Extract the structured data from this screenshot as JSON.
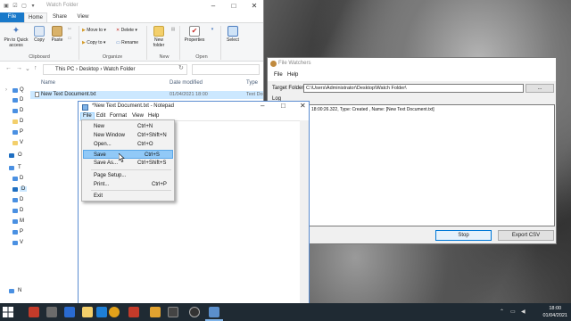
{
  "explorer": {
    "title": "Watch Folder",
    "tabs": [
      "File",
      "Home",
      "Share",
      "View"
    ],
    "clipboard": {
      "pin_label": "Pin to Quick access",
      "copy_label": "Copy",
      "paste_label": "Paste",
      "group_label": "Clipboard"
    },
    "organize": {
      "move_to": "Move to",
      "copy_to": "Copy to",
      "delete": "Delete",
      "rename": "Rename",
      "group_label": "Organize"
    },
    "new": {
      "new_folder": "New folder",
      "group_label": "New"
    },
    "open": {
      "properties": "Properties",
      "group_label": "Open"
    },
    "select": {
      "select": "Select"
    },
    "breadcrumb": [
      "This PC",
      "Desktop",
      "Watch Folder"
    ],
    "columns": {
      "name": "Name",
      "date_modified": "Date modified",
      "type": "Type"
    },
    "files": [
      {
        "name": "New Text Document.txt",
        "date": "01/04/2021 18:00",
        "type": "Text Do"
      }
    ],
    "sidebar_labels": [
      "Q",
      "D",
      "D",
      "D",
      "P",
      "V",
      "O",
      "T",
      "D",
      "D",
      "D",
      "D",
      "M",
      "P",
      "V",
      "N"
    ]
  },
  "notepad": {
    "title": "*New Text Document.txt - Notepad",
    "menu": [
      "File",
      "Edit",
      "Format",
      "View",
      "Help"
    ]
  },
  "file_menu": {
    "items": [
      {
        "label": "New",
        "shortcut": "Ctrl+N"
      },
      {
        "label": "New Window",
        "shortcut": "Ctrl+Shift+N"
      },
      {
        "label": "Open...",
        "shortcut": "Ctrl+O"
      },
      {
        "label": "Save",
        "shortcut": "Ctrl+S"
      },
      {
        "label": "Save As...",
        "shortcut": "Ctrl+Shift+S"
      },
      {
        "label": "Page Setup...",
        "shortcut": ""
      },
      {
        "label": "Print...",
        "shortcut": "Ctrl+P"
      },
      {
        "label": "Exit",
        "shortcut": ""
      }
    ],
    "highlighted": "Save"
  },
  "file_watchers": {
    "title": "File Watchers",
    "menu": [
      "File",
      "Help"
    ],
    "target_label": "Target Folder:",
    "target_value": "C:\\Users\\Administrator\\Desktop\\Watch Folder\\",
    "browse_label": "...",
    "log_label": "Log",
    "log_lines": [
      "18:00:26.322, Type: Created , Name: [New Text Document.txt]"
    ],
    "stop_label": "Stop",
    "export_label": "Export CSV"
  },
  "taskbar": {
    "time": "18:00",
    "date": "01/04/2021"
  },
  "colors": {
    "accent": "#1979ca",
    "selection": "#cce8ff",
    "taskbar": "#1f2a33"
  }
}
